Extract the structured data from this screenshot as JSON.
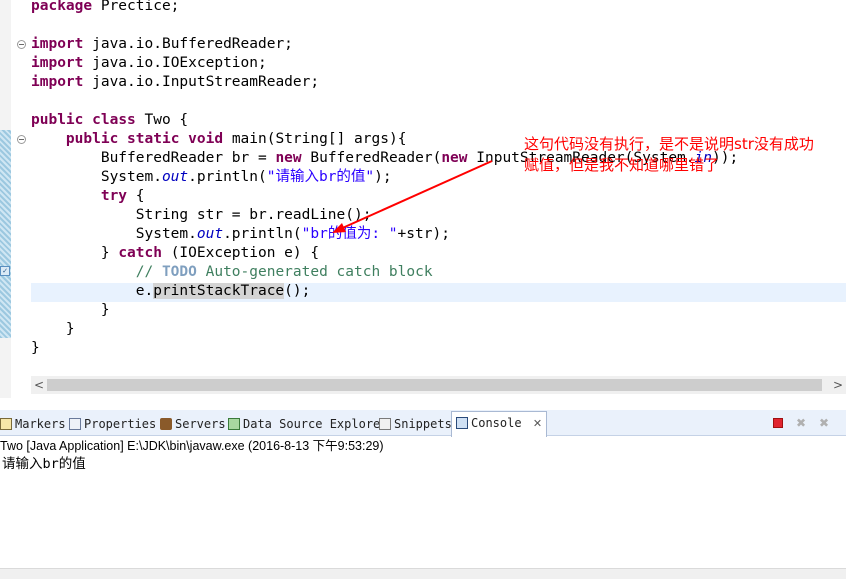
{
  "editor": {
    "lines": {
      "l1": {
        "a": "package",
        "b": " Prectice;"
      },
      "l2": {
        "a": "import",
        "b": " java.io.BufferedReader;"
      },
      "l3": {
        "a": "import",
        "b": " java.io.IOException;"
      },
      "l4": {
        "a": "import",
        "b": " java.io.InputStreamReader;"
      },
      "l5": {
        "a": "public",
        "b": " ",
        "c": "class",
        "d": " Two {"
      },
      "l6": {
        "a": "    public",
        "b": " ",
        "c": "static",
        "d": " ",
        "e": "void",
        "f": " main(String[] args){"
      },
      "l7": {
        "a": "        BufferedReader br = ",
        "b": "new",
        "c": " BufferedReader(",
        "d": "new",
        "e": " InputStreamReader(System.",
        "f": "in",
        "g": "));"
      },
      "l8": {
        "a": "        System.",
        "b": "out",
        "c": ".println(",
        "d": "\"请输入br的值\"",
        "e": ");"
      },
      "l9": {
        "a": "        ",
        "b": "try",
        "c": " {"
      },
      "l10": {
        "a": "            String str = br.readLine();"
      },
      "l11": {
        "a": "            System.",
        "b": "out",
        "c": ".println(",
        "d": "\"br的值为: \"",
        "e": "+str);"
      },
      "l12": {
        "a": "        } ",
        "b": "catch",
        "c": " (IOException e) {"
      },
      "l13": {
        "a": "            // ",
        "b": "TODO",
        "c": " Auto-generated catch block"
      },
      "l14": {
        "a": "            e.",
        "b": "printStackTrace",
        "c": "();"
      },
      "l15": {
        "a": "        }"
      },
      "l16": {
        "a": "    }"
      },
      "l17": {
        "a": "}"
      }
    },
    "annotation": {
      "line1": "这句代码没有执行，是不是说明str没有成功",
      "line2": "赋值，但是我不知道哪里错了"
    },
    "scroll_left": "<",
    "scroll_right": ">"
  },
  "tabs": {
    "markers": "Markers",
    "properties": "Properties",
    "servers": "Servers",
    "data_source_explorer": "Data Source Explorer",
    "snippets": "Snippets",
    "console": "Console",
    "console_close": "✕"
  },
  "console": {
    "status": "Two [Java Application] E:\\JDK\\bin\\javaw.exe (2016-8-13 下午9:53:29)",
    "output": "请输入br的值"
  },
  "icons": {
    "terminate": "stop-icon",
    "remove_launch": "remove-launch-icon",
    "remove_all": "remove-all-icon"
  },
  "colors": {
    "keyword": "#7f0055",
    "string": "#2a00ff",
    "field": "#0000c0",
    "comment": "#3f7f5f",
    "annotation": "#ff0000",
    "terminate": "#e0242f"
  }
}
